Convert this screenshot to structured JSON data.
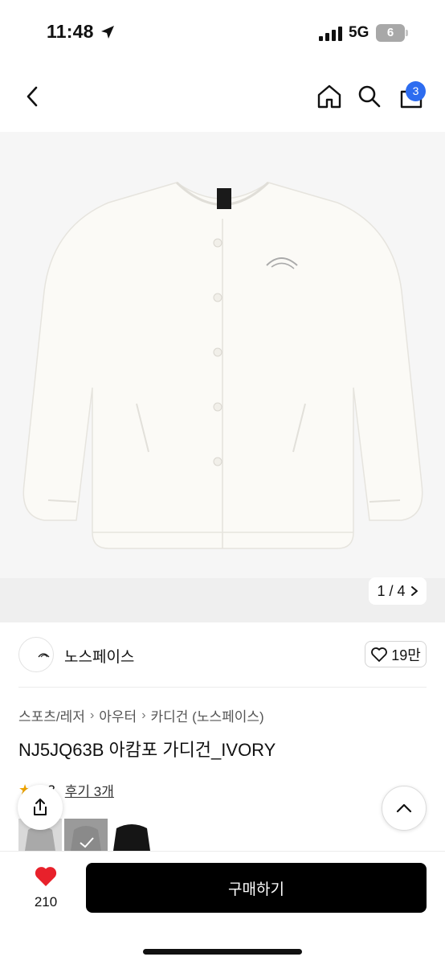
{
  "status_bar": {
    "time": "11:48",
    "network": "5G",
    "battery": "6"
  },
  "header": {
    "cart_count": "3"
  },
  "gallery": {
    "pager_text": "1 / 4"
  },
  "brand": {
    "name": "노스페이스",
    "logo_text": "THE NORTH FACE",
    "likes": "19만"
  },
  "breadcrumb": [
    "스포츠/레저",
    "아우터",
    "카디건 (노스페이스)"
  ],
  "product": {
    "title": "NJ5JQ63B 아캄포 가디건_IVORY",
    "rating": "4.3",
    "reviews": "후기 3개"
  },
  "bottom": {
    "wish_count": "210",
    "buy_label": "구매하기"
  },
  "colors": {
    "accent": "#2d6cf0",
    "heart": "#e8212b",
    "star": "#f0a500",
    "buy_button": "#000000"
  }
}
